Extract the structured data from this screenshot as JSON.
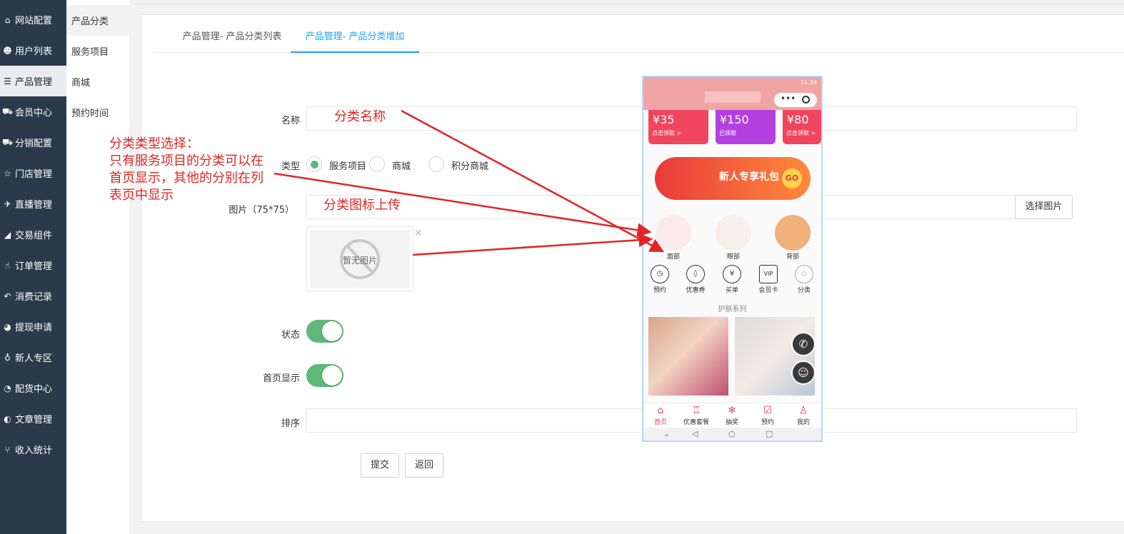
{
  "sidebar": {
    "items": [
      {
        "icon": "home-icon",
        "glyph": "⌂",
        "label": "网站配置"
      },
      {
        "icon": "user-icon",
        "glyph": "☻",
        "label": "用户列表"
      },
      {
        "icon": "server-icon",
        "glyph": "☰",
        "label": "产品管理"
      },
      {
        "icon": "cart-icon",
        "glyph": "⛟",
        "label": "会员中心"
      },
      {
        "icon": "cart-icon",
        "glyph": "⛟",
        "label": "分销配置"
      },
      {
        "icon": "star-icon",
        "glyph": "☆",
        "label": "门店管理"
      },
      {
        "icon": "plane-icon",
        "glyph": "✈",
        "label": "直播管理"
      },
      {
        "icon": "eraser-icon",
        "glyph": "◢",
        "label": "交易组件"
      },
      {
        "icon": "thumbs-up-icon",
        "glyph": "☝",
        "label": "订单管理"
      },
      {
        "icon": "reply-icon",
        "glyph": "↶",
        "label": "消费记录"
      },
      {
        "icon": "wechat-icon",
        "glyph": "◕",
        "label": "提现申请"
      },
      {
        "icon": "location-pin-icon",
        "glyph": "♁",
        "label": "新人专区"
      },
      {
        "icon": "pie-chart-icon",
        "glyph": "◔",
        "label": "配货中心"
      },
      {
        "icon": "contrast-icon",
        "glyph": "◐",
        "label": "文章管理"
      },
      {
        "icon": "branch-icon",
        "glyph": "⑂",
        "label": "收入统计"
      }
    ]
  },
  "submenu": {
    "items": [
      {
        "label": "产品分类"
      },
      {
        "label": "服务项目"
      },
      {
        "label": "商城"
      },
      {
        "label": "预约时间"
      }
    ]
  },
  "tabs": [
    {
      "label": "产品管理- 产品分类列表"
    },
    {
      "label": "产品管理- 产品分类增加"
    }
  ],
  "form": {
    "name_label": "名称",
    "type_label": "类型",
    "type_options": [
      {
        "label": "服务项目",
        "checked": true
      },
      {
        "label": "商城",
        "checked": false
      },
      {
        "label": "积分商城",
        "checked": false
      }
    ],
    "image_label": "图片（75*75）",
    "choose_image_label": "选择图片",
    "no_image_text": "暂无图片",
    "remove_symbol": "✕",
    "status_label": "状态",
    "status_on": true,
    "home_label": "首页显示",
    "home_on": true,
    "sort_label": "排序",
    "submit_label": "提交",
    "back_label": "返回"
  },
  "annotations": {
    "name": "分类名称",
    "type": "分类类型选择：\n只有服务项目的分类可以在\n首页显示，其他的分别在列\n表页中显示",
    "image": "分类图标上传"
  },
  "phone": {
    "status_text": "11:34",
    "coupons": [
      {
        "value": "¥35",
        "sub": "点击领取 >",
        "color": "#f0455f"
      },
      {
        "value": "¥150",
        "sub": "已领取",
        "color": "#b43fe0"
      },
      {
        "value": "¥80",
        "sub": "点击领取 >",
        "color": "#f0455f"
      }
    ],
    "banner_text": "新人专享礼包",
    "banner_go": "GO",
    "categories": [
      {
        "label": "面部"
      },
      {
        "label": "眼部"
      },
      {
        "label": "背部"
      }
    ],
    "icons": [
      {
        "icon": "clock-icon",
        "glyph": "◷",
        "label": "预约"
      },
      {
        "icon": "tag-icon",
        "glyph": "◊",
        "label": "优惠券"
      },
      {
        "icon": "yen-icon",
        "glyph": "¥",
        "label": "买单"
      },
      {
        "icon": "vip-card-icon",
        "glyph": "VIP",
        "label": "会员卡"
      },
      {
        "icon": "diamond-icon",
        "glyph": "◇",
        "label": "分类"
      }
    ],
    "series_title": "护肤系列",
    "tabbar": [
      {
        "icon": "home-icon",
        "glyph": "⌂",
        "label": "首页",
        "active": true
      },
      {
        "icon": "shirt-icon",
        "glyph": "♖",
        "label": "优惠套餐",
        "active": false
      },
      {
        "icon": "snowflake-icon",
        "glyph": "❄",
        "label": "抽奖",
        "active": false
      },
      {
        "icon": "checklist-icon",
        "glyph": "☑",
        "label": "预约",
        "active": false
      },
      {
        "icon": "person-icon",
        "glyph": "♙",
        "label": "我的",
        "active": false
      }
    ],
    "nav": [
      {
        "icon": "chevron-down-icon",
        "glyph": "⌄"
      },
      {
        "icon": "back-triangle-icon",
        "glyph": "◁"
      },
      {
        "icon": "home-circle-icon",
        "glyph": "○"
      },
      {
        "icon": "recent-square-icon",
        "glyph": "□"
      }
    ],
    "phone_glyph": "✆",
    "service_glyph": "☺"
  },
  "colors": {
    "sidebar_bg": "#2b3a4a",
    "accent_blue": "#1e9fff",
    "switch_green": "#5fb878",
    "annotation_red": "#e32424"
  }
}
